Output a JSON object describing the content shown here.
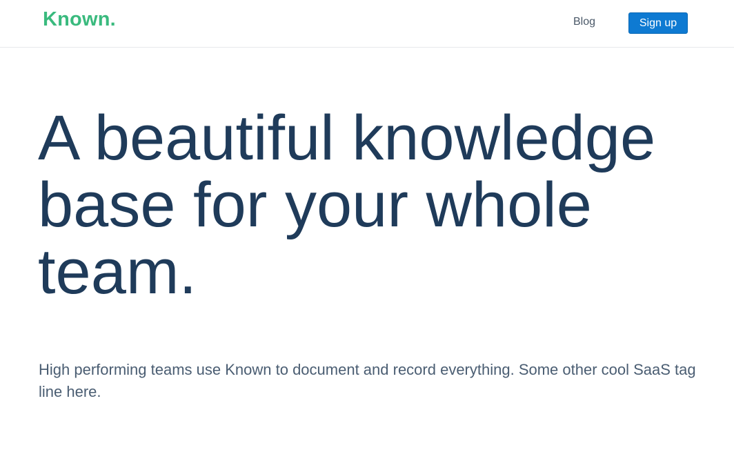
{
  "header": {
    "logo": "Known.",
    "nav": {
      "blog_label": "Blog",
      "signup_label": "Sign up"
    }
  },
  "hero": {
    "title": "A beautiful knowledge base for your whole team.",
    "subtitle": "High performing teams use Known to document and record everything. Some other cool SaaS tag line here."
  },
  "colors": {
    "brand": "#3aba7e",
    "primary_button": "#0e7ad2",
    "heading": "#1f3b5a",
    "body_text": "#4a5d72"
  }
}
